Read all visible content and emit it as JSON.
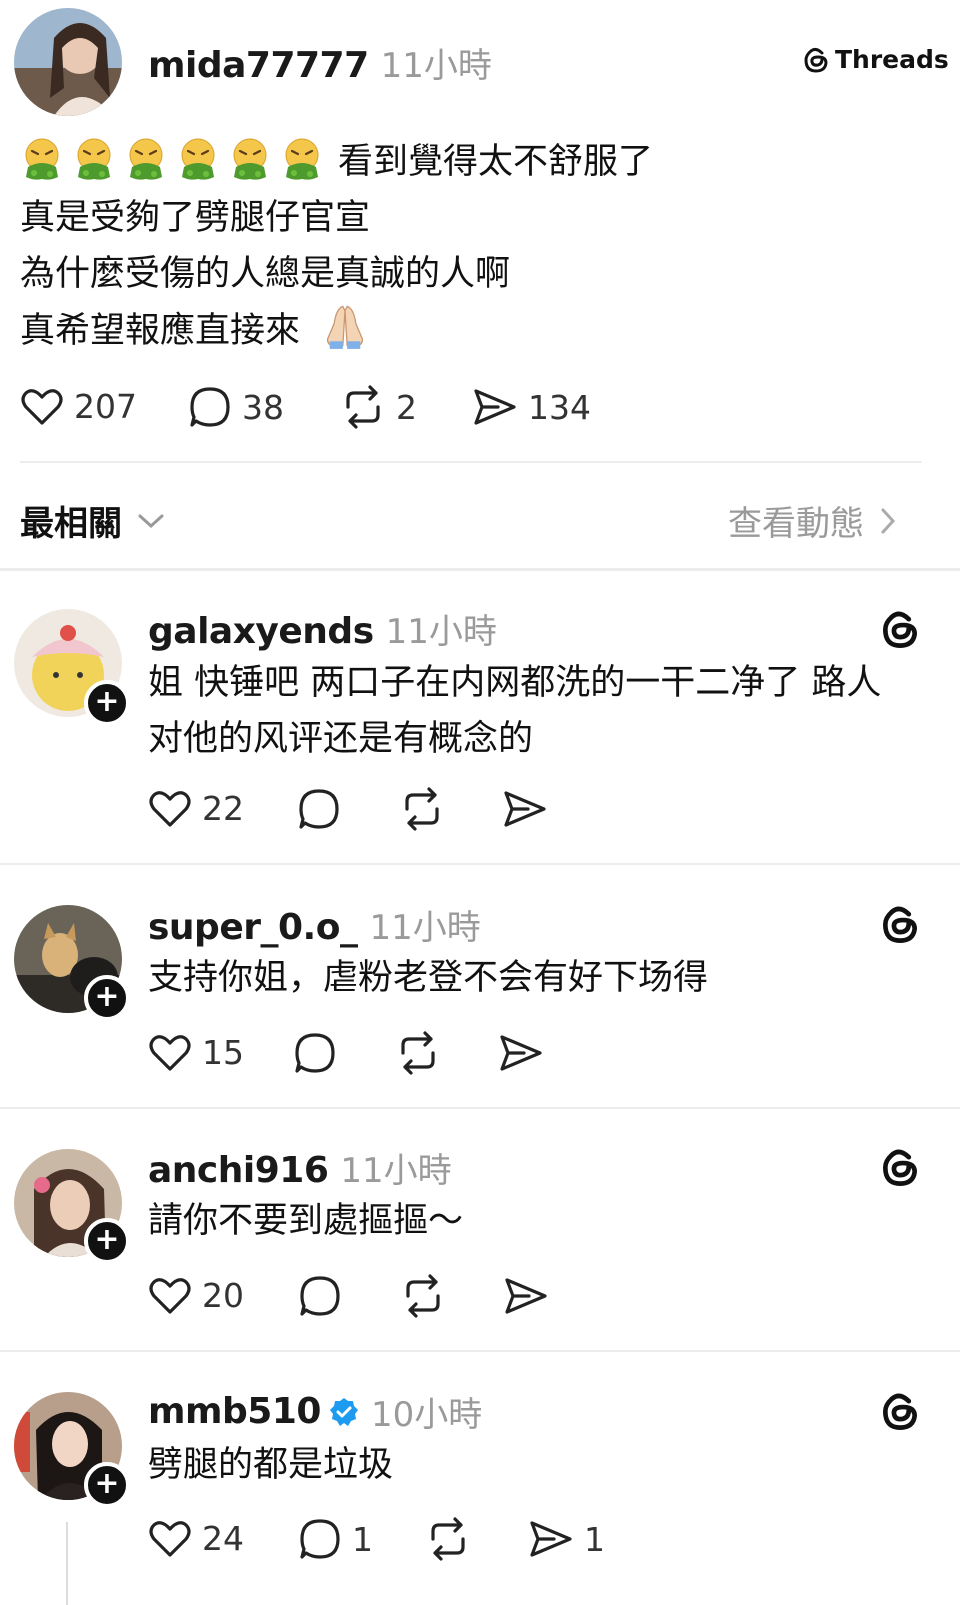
{
  "post": {
    "username": "mida77777",
    "time": "11小時",
    "brand": "Threads",
    "line1_text": "看到覺得太不舒服了",
    "line2": "真是受夠了劈腿仔官宣",
    "line3": "為什麼受傷的人總是真誠的人啊",
    "line4": "真希望報應直接來",
    "emoji_line1": [
      "nauseated-face-icon",
      "nauseated-face-icon",
      "nauseated-face-icon",
      "nauseated-face-icon",
      "nauseated-face-icon",
      "nauseated-face-icon"
    ],
    "emoji_line4": "folded-hands-icon",
    "likes": "207",
    "replies": "38",
    "reposts": "2",
    "shares": "134"
  },
  "sort": {
    "label": "最相關",
    "view_activity": "查看動態"
  },
  "comments": [
    {
      "username": "galaxyends",
      "time": "11小時",
      "line1": "姐 快锤吧 两口子在内网都洗的一干二净了 路人",
      "line2": "对他的风评还是有概念的",
      "likes": "22"
    },
    {
      "username": "super_0.o_",
      "time": "11小時",
      "line1": "支持你姐，虐粉老登不会有好下场得",
      "likes": "15"
    },
    {
      "username": "anchi916",
      "time": "11小時",
      "line1": "請你不要到處摳摳～",
      "likes": "20"
    },
    {
      "username": "mmb510",
      "time": "10小時",
      "verified": true,
      "line1": "劈腿的都是垃圾",
      "likes": "24",
      "replies": "1",
      "shares": "1"
    }
  ],
  "colors": {
    "verified": "#1d9bf0",
    "muted": "#9a9a9a",
    "divider": "#ececec"
  }
}
